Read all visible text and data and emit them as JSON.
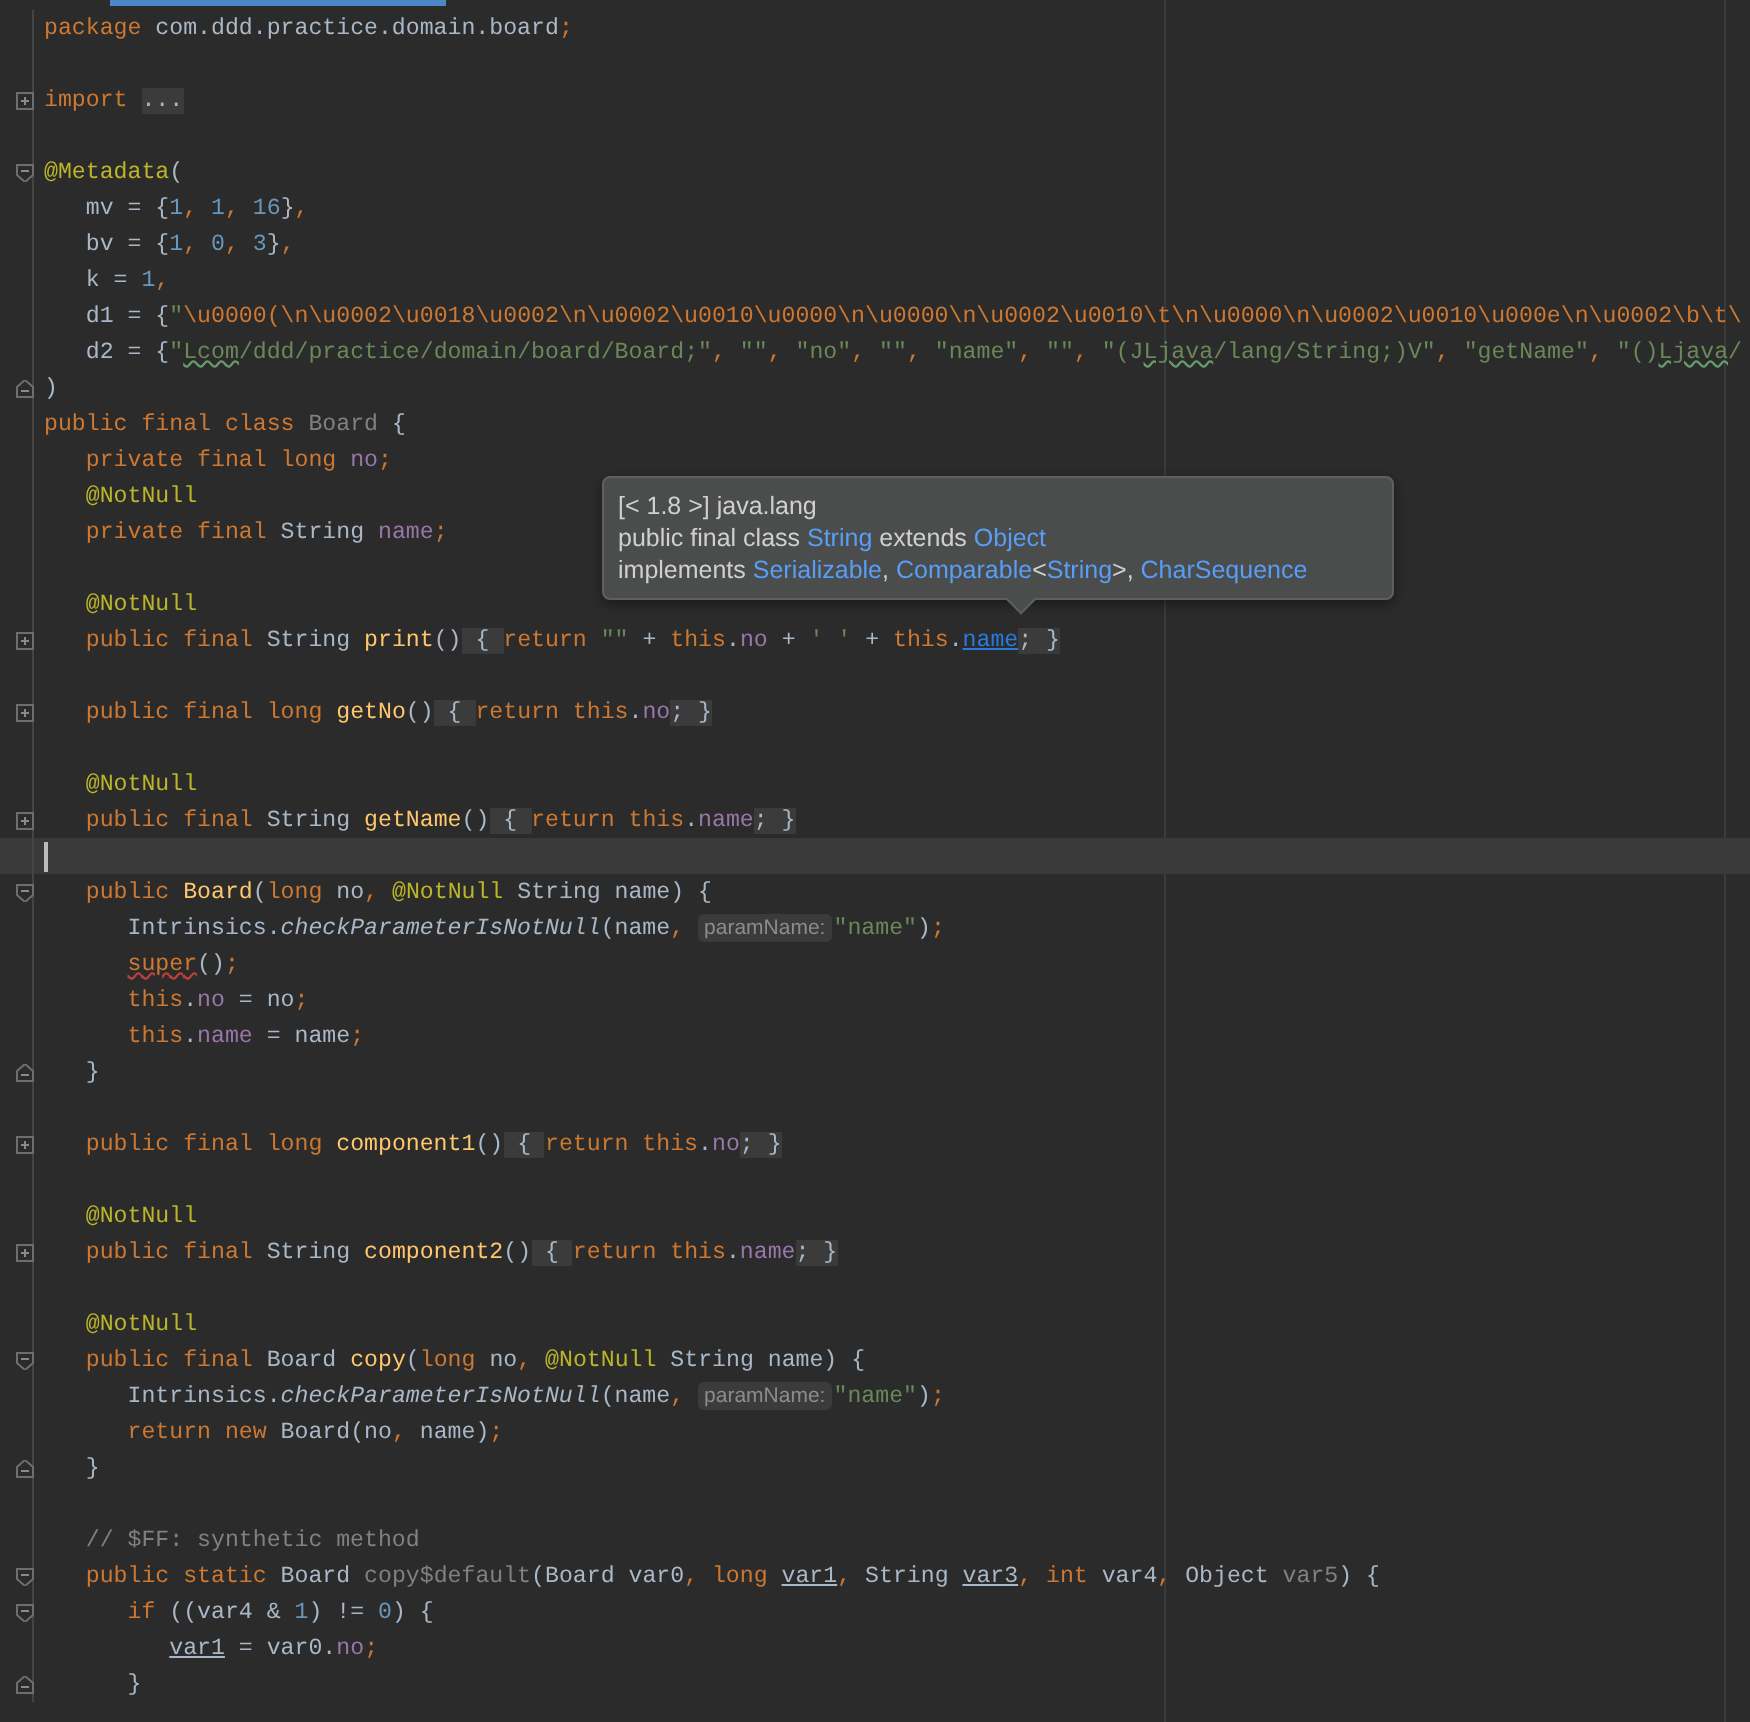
{
  "editor": {
    "lines": [
      {
        "kind": "code",
        "tokens": [
          {
            "kind": "kw",
            "text": "package"
          },
          {
            "kind": "plain",
            "text": " com.ddd.practice.domain.board"
          },
          {
            "kind": "kw",
            "text": ";"
          }
        ]
      },
      {
        "kind": "blank"
      },
      {
        "kind": "code",
        "gutter": {
          "kind": "collapsed"
        },
        "tokens": [
          {
            "kind": "kw",
            "text": "import "
          },
          {
            "kind": "fold",
            "text": "..."
          }
        ]
      },
      {
        "kind": "blank"
      },
      {
        "kind": "code",
        "gutter": {
          "kind": "open"
        },
        "tokens": [
          {
            "kind": "ann",
            "text": "@Metadata"
          },
          {
            "kind": "plain",
            "text": "("
          }
        ]
      },
      {
        "kind": "code",
        "tokens": [
          {
            "kind": "plain",
            "text": "   mv = {"
          },
          {
            "kind": "num",
            "text": "1"
          },
          {
            "kind": "kw",
            "text": ", "
          },
          {
            "kind": "num",
            "text": "1"
          },
          {
            "kind": "kw",
            "text": ", "
          },
          {
            "kind": "num",
            "text": "16"
          },
          {
            "kind": "plain",
            "text": "}"
          },
          {
            "kind": "kw",
            "text": ","
          }
        ]
      },
      {
        "kind": "code",
        "tokens": [
          {
            "kind": "plain",
            "text": "   bv = {"
          },
          {
            "kind": "num",
            "text": "1"
          },
          {
            "kind": "kw",
            "text": ", "
          },
          {
            "kind": "num",
            "text": "0"
          },
          {
            "kind": "kw",
            "text": ", "
          },
          {
            "kind": "num",
            "text": "3"
          },
          {
            "kind": "plain",
            "text": "}"
          },
          {
            "kind": "kw",
            "text": ","
          }
        ]
      },
      {
        "kind": "code",
        "tokens": [
          {
            "kind": "plain",
            "text": "   k = "
          },
          {
            "kind": "num",
            "text": "1"
          },
          {
            "kind": "kw",
            "text": ","
          }
        ]
      },
      {
        "kind": "code",
        "tokens": [
          {
            "kind": "plain",
            "text": "   d1 = {"
          },
          {
            "kind": "str",
            "text": "\""
          },
          {
            "kind": "escape",
            "text": "\\u0000(\\n\\u0002\\u0018\\u0002\\n\\u0002\\u0010\\u0000\\n\\u0000\\n\\u0002\\u0010\\t\\n\\u0000\\n\\u0002\\u0010\\u000e\\n\\u0002\\b\\t\\"
          }
        ]
      },
      {
        "kind": "code",
        "tokens": [
          {
            "kind": "plain",
            "text": "   d2 = {"
          },
          {
            "kind": "str",
            "text": "\""
          },
          {
            "kind": "str",
            "text": "Lcom",
            "typo": true
          },
          {
            "kind": "str",
            "text": "/ddd/practice/domain/board/Board;\""
          },
          {
            "kind": "kw",
            "text": ", "
          },
          {
            "kind": "str",
            "text": "\"\""
          },
          {
            "kind": "kw",
            "text": ", "
          },
          {
            "kind": "str",
            "text": "\"no\""
          },
          {
            "kind": "kw",
            "text": ", "
          },
          {
            "kind": "str",
            "text": "\"\""
          },
          {
            "kind": "kw",
            "text": ", "
          },
          {
            "kind": "str",
            "text": "\"name\""
          },
          {
            "kind": "kw",
            "text": ", "
          },
          {
            "kind": "str",
            "text": "\"\""
          },
          {
            "kind": "kw",
            "text": ", "
          },
          {
            "kind": "str",
            "text": "\"(J"
          },
          {
            "kind": "str",
            "text": "Ljava",
            "typo": true
          },
          {
            "kind": "str",
            "text": "/lang/String;)V\""
          },
          {
            "kind": "kw",
            "text": ", "
          },
          {
            "kind": "str",
            "text": "\"getName\""
          },
          {
            "kind": "kw",
            "text": ", "
          },
          {
            "kind": "str",
            "text": "\"()"
          },
          {
            "kind": "str",
            "text": "Ljava",
            "typo": true
          },
          {
            "kind": "str",
            "text": "/"
          }
        ]
      },
      {
        "kind": "code",
        "gutter": {
          "kind": "end"
        },
        "tokens": [
          {
            "kind": "plain",
            "text": ")"
          }
        ]
      },
      {
        "kind": "code",
        "tokens": [
          {
            "kind": "kw",
            "text": "public final class "
          },
          {
            "kind": "dim",
            "text": "Board"
          },
          {
            "kind": "plain",
            "text": " {"
          }
        ]
      },
      {
        "kind": "code",
        "tokens": [
          {
            "kind": "kw",
            "text": "   private final long "
          },
          {
            "kind": "field",
            "text": "no"
          },
          {
            "kind": "kw",
            "text": ";"
          }
        ]
      },
      {
        "kind": "code",
        "tokens": [
          {
            "kind": "ann",
            "text": "   @NotNull"
          }
        ]
      },
      {
        "kind": "code",
        "tokens": [
          {
            "kind": "kw",
            "text": "   private final "
          },
          {
            "kind": "plain",
            "text": "String "
          },
          {
            "kind": "field",
            "text": "name"
          },
          {
            "kind": "kw",
            "text": ";"
          }
        ]
      },
      {
        "kind": "blank"
      },
      {
        "kind": "code",
        "tokens": [
          {
            "kind": "ann",
            "text": "   @NotNull"
          }
        ]
      },
      {
        "kind": "code",
        "gutter": {
          "kind": "collapsed"
        },
        "tokens": [
          {
            "kind": "kw",
            "text": "   public final "
          },
          {
            "kind": "plain",
            "text": "String "
          },
          {
            "kind": "decl",
            "text": "print"
          },
          {
            "kind": "plain",
            "text": "()"
          },
          {
            "kind": "fold",
            "text": " { "
          },
          {
            "kind": "kw",
            "text": "return "
          },
          {
            "kind": "str",
            "text": "\"\""
          },
          {
            "kind": "plain",
            "text": " + "
          },
          {
            "kind": "kw",
            "text": "this"
          },
          {
            "kind": "plain",
            "text": "."
          },
          {
            "kind": "field",
            "text": "no"
          },
          {
            "kind": "plain",
            "text": " + "
          },
          {
            "kind": "str",
            "text": "' '"
          },
          {
            "kind": "plain",
            "text": " + "
          },
          {
            "kind": "kw",
            "text": "this"
          },
          {
            "kind": "plain",
            "text": "."
          },
          {
            "kind": "link",
            "text": "name"
          },
          {
            "kind": "fold",
            "text": "; }"
          }
        ]
      },
      {
        "kind": "blank"
      },
      {
        "kind": "code",
        "gutter": {
          "kind": "collapsed"
        },
        "tokens": [
          {
            "kind": "kw",
            "text": "   public final long "
          },
          {
            "kind": "decl",
            "text": "getNo"
          },
          {
            "kind": "plain",
            "text": "()"
          },
          {
            "kind": "fold",
            "text": " { "
          },
          {
            "kind": "kw",
            "text": "return this"
          },
          {
            "kind": "plain",
            "text": "."
          },
          {
            "kind": "field",
            "text": "no"
          },
          {
            "kind": "fold",
            "text": "; }"
          }
        ]
      },
      {
        "kind": "blank"
      },
      {
        "kind": "code",
        "tokens": [
          {
            "kind": "ann",
            "text": "   @NotNull"
          }
        ]
      },
      {
        "kind": "code",
        "gutter": {
          "kind": "collapsed"
        },
        "tokens": [
          {
            "kind": "kw",
            "text": "   public final "
          },
          {
            "kind": "plain",
            "text": "String "
          },
          {
            "kind": "decl",
            "text": "getName"
          },
          {
            "kind": "plain",
            "text": "()"
          },
          {
            "kind": "fold",
            "text": " { "
          },
          {
            "kind": "kw",
            "text": "return this"
          },
          {
            "kind": "plain",
            "text": "."
          },
          {
            "kind": "field",
            "text": "name"
          },
          {
            "kind": "fold",
            "text": "; }"
          }
        ]
      },
      {
        "kind": "blank",
        "caret": true
      },
      {
        "kind": "code",
        "gutter": {
          "kind": "open"
        },
        "tokens": [
          {
            "kind": "kw",
            "text": "   public "
          },
          {
            "kind": "decl",
            "text": "Board"
          },
          {
            "kind": "plain",
            "text": "("
          },
          {
            "kind": "kw",
            "text": "long "
          },
          {
            "kind": "plain",
            "text": "no"
          },
          {
            "kind": "kw",
            "text": ", "
          },
          {
            "kind": "ann",
            "text": "@NotNull "
          },
          {
            "kind": "plain",
            "text": "String name) {"
          }
        ]
      },
      {
        "kind": "code",
        "tokens": [
          {
            "kind": "plain",
            "text": "      Intrinsics."
          },
          {
            "kind": "italic",
            "text": "checkParameterIsNotNull"
          },
          {
            "kind": "plain",
            "text": "(name"
          },
          {
            "kind": "kw",
            "text": ", "
          },
          {
            "kind": "hint",
            "text": "paramName:"
          },
          {
            "kind": "str",
            "text": "\"name\""
          },
          {
            "kind": "plain",
            "text": ")"
          },
          {
            "kind": "kw",
            "text": ";"
          }
        ]
      },
      {
        "kind": "code",
        "tokens": [
          {
            "kind": "kw",
            "text": "      super",
            "error": true
          },
          {
            "kind": "plain",
            "text": "()"
          },
          {
            "kind": "kw",
            "text": ";"
          }
        ]
      },
      {
        "kind": "code",
        "tokens": [
          {
            "kind": "kw",
            "text": "      this"
          },
          {
            "kind": "plain",
            "text": "."
          },
          {
            "kind": "field",
            "text": "no"
          },
          {
            "kind": "plain",
            "text": " = no"
          },
          {
            "kind": "kw",
            "text": ";"
          }
        ]
      },
      {
        "kind": "code",
        "tokens": [
          {
            "kind": "kw",
            "text": "      this"
          },
          {
            "kind": "plain",
            "text": "."
          },
          {
            "kind": "field",
            "text": "name"
          },
          {
            "kind": "plain",
            "text": " = name"
          },
          {
            "kind": "kw",
            "text": ";"
          }
        ]
      },
      {
        "kind": "code",
        "gutter": {
          "kind": "end"
        },
        "tokens": [
          {
            "kind": "plain",
            "text": "   }"
          }
        ]
      },
      {
        "kind": "blank"
      },
      {
        "kind": "code",
        "gutter": {
          "kind": "collapsed"
        },
        "tokens": [
          {
            "kind": "kw",
            "text": "   public final long "
          },
          {
            "kind": "decl",
            "text": "component1"
          },
          {
            "kind": "plain",
            "text": "()"
          },
          {
            "kind": "fold",
            "text": " { "
          },
          {
            "kind": "kw",
            "text": "return this"
          },
          {
            "kind": "plain",
            "text": "."
          },
          {
            "kind": "field",
            "text": "no"
          },
          {
            "kind": "fold",
            "text": "; }"
          }
        ]
      },
      {
        "kind": "blank"
      },
      {
        "kind": "code",
        "tokens": [
          {
            "kind": "ann",
            "text": "   @NotNull"
          }
        ]
      },
      {
        "kind": "code",
        "gutter": {
          "kind": "collapsed"
        },
        "tokens": [
          {
            "kind": "kw",
            "text": "   public final "
          },
          {
            "kind": "plain",
            "text": "String "
          },
          {
            "kind": "decl",
            "text": "component2"
          },
          {
            "kind": "plain",
            "text": "()"
          },
          {
            "kind": "fold",
            "text": " { "
          },
          {
            "kind": "kw",
            "text": "return this"
          },
          {
            "kind": "plain",
            "text": "."
          },
          {
            "kind": "field",
            "text": "name"
          },
          {
            "kind": "fold",
            "text": "; }"
          }
        ]
      },
      {
        "kind": "blank"
      },
      {
        "kind": "code",
        "tokens": [
          {
            "kind": "ann",
            "text": "   @NotNull"
          }
        ]
      },
      {
        "kind": "code",
        "gutter": {
          "kind": "open"
        },
        "tokens": [
          {
            "kind": "kw",
            "text": "   public final "
          },
          {
            "kind": "plain",
            "text": "Board "
          },
          {
            "kind": "decl",
            "text": "copy"
          },
          {
            "kind": "plain",
            "text": "("
          },
          {
            "kind": "kw",
            "text": "long "
          },
          {
            "kind": "plain",
            "text": "no"
          },
          {
            "kind": "kw",
            "text": ", "
          },
          {
            "kind": "ann",
            "text": "@NotNull "
          },
          {
            "kind": "plain",
            "text": "String name) {"
          }
        ]
      },
      {
        "kind": "code",
        "tokens": [
          {
            "kind": "plain",
            "text": "      Intrinsics."
          },
          {
            "kind": "italic",
            "text": "checkParameterIsNotNull"
          },
          {
            "kind": "plain",
            "text": "(name"
          },
          {
            "kind": "kw",
            "text": ", "
          },
          {
            "kind": "hint",
            "text": "paramName:"
          },
          {
            "kind": "str",
            "text": "\"name\""
          },
          {
            "kind": "plain",
            "text": ")"
          },
          {
            "kind": "kw",
            "text": ";"
          }
        ]
      },
      {
        "kind": "code",
        "tokens": [
          {
            "kind": "kw",
            "text": "      return new "
          },
          {
            "kind": "plain",
            "text": "Board(no"
          },
          {
            "kind": "kw",
            "text": ", "
          },
          {
            "kind": "plain",
            "text": "name)"
          },
          {
            "kind": "kw",
            "text": ";"
          }
        ]
      },
      {
        "kind": "code",
        "gutter": {
          "kind": "end"
        },
        "tokens": [
          {
            "kind": "plain",
            "text": "   }"
          }
        ]
      },
      {
        "kind": "blank"
      },
      {
        "kind": "code",
        "tokens": [
          {
            "kind": "comment",
            "text": "   // $FF: synthetic method"
          }
        ]
      },
      {
        "kind": "code",
        "gutter": {
          "kind": "open"
        },
        "tokens": [
          {
            "kind": "kw",
            "text": "   public static "
          },
          {
            "kind": "plain",
            "text": "Board "
          },
          {
            "kind": "dim",
            "text": "copy$default"
          },
          {
            "kind": "plain",
            "text": "(Board var0"
          },
          {
            "kind": "kw",
            "text": ", long "
          },
          {
            "kind": "plain",
            "text": "var1",
            "underlined": true
          },
          {
            "kind": "kw",
            "text": ", "
          },
          {
            "kind": "plain",
            "text": "String "
          },
          {
            "kind": "plain",
            "text": "var3",
            "underlined": true
          },
          {
            "kind": "kw",
            "text": ", int "
          },
          {
            "kind": "plain",
            "text": "var4"
          },
          {
            "kind": "kw",
            "text": ", "
          },
          {
            "kind": "plain",
            "text": "Object "
          },
          {
            "kind": "dim",
            "text": "var5"
          },
          {
            "kind": "plain",
            "text": ") {"
          }
        ]
      },
      {
        "kind": "code",
        "gutter": {
          "kind": "open"
        },
        "tokens": [
          {
            "kind": "kw",
            "text": "      if "
          },
          {
            "kind": "plain",
            "text": "((var4 & "
          },
          {
            "kind": "num",
            "text": "1"
          },
          {
            "kind": "plain",
            "text": ") != "
          },
          {
            "kind": "num",
            "text": "0"
          },
          {
            "kind": "plain",
            "text": ") {"
          }
        ]
      },
      {
        "kind": "code",
        "tokens": [
          {
            "kind": "plain",
            "text": "         var1",
            "underlined": true
          },
          {
            "kind": "plain",
            "text": " = var0."
          },
          {
            "kind": "field",
            "text": "no"
          },
          {
            "kind": "kw",
            "text": ";"
          }
        ]
      },
      {
        "kind": "code",
        "gutter": {
          "kind": "end"
        },
        "tokens": [
          {
            "kind": "plain",
            "text": "      }"
          }
        ]
      }
    ]
  },
  "tooltip": {
    "lines": [
      [
        {
          "kind": "text",
          "text": "[< 1.8 >] java.lang"
        }
      ],
      [
        {
          "kind": "text",
          "text": "public final class "
        },
        {
          "kind": "link",
          "text": "String"
        },
        {
          "kind": "text",
          "text": " extends "
        },
        {
          "kind": "link",
          "text": "Object"
        }
      ],
      [
        {
          "kind": "text",
          "text": "implements "
        },
        {
          "kind": "link",
          "text": "Serializable"
        },
        {
          "kind": "text",
          "text": ", "
        },
        {
          "kind": "link",
          "text": "Comparable"
        },
        {
          "kind": "text",
          "text": "<"
        },
        {
          "kind": "link",
          "text": "String"
        },
        {
          "kind": "text",
          "text": ">, "
        },
        {
          "kind": "link",
          "text": "CharSequence"
        }
      ]
    ]
  }
}
